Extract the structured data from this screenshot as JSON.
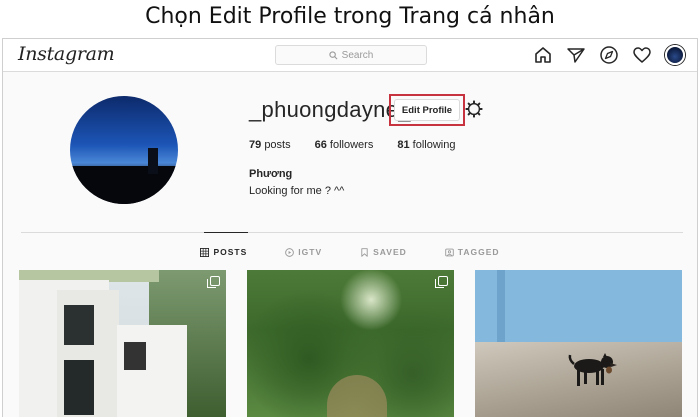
{
  "caption": "Chọn Edit Profile trong Trang cá nhân",
  "nav": {
    "logo": "Instagram",
    "search_placeholder": "Search",
    "icons": [
      "home-icon",
      "direct-icon",
      "explore-icon",
      "activity-heart-icon",
      "profile-avatar"
    ]
  },
  "profile": {
    "username": "_phuongdayne_",
    "edit_button": "Edit Profile",
    "highlight_color": "#c7343f",
    "stats": {
      "posts_count": "79",
      "posts_label": "posts",
      "followers_count": "66",
      "followers_label": "followers",
      "following_count": "81",
      "following_label": "following"
    },
    "full_name": "Phương",
    "bio": "Looking for me ? ^^"
  },
  "tabs": [
    {
      "label": "POSTS",
      "icon": "grid-icon",
      "active": true
    },
    {
      "label": "IGTV",
      "icon": "igtv-icon",
      "active": false
    },
    {
      "label": "SAVED",
      "icon": "bookmark-icon",
      "active": false
    },
    {
      "label": "TAGGED",
      "icon": "tag-icon",
      "active": false
    }
  ]
}
